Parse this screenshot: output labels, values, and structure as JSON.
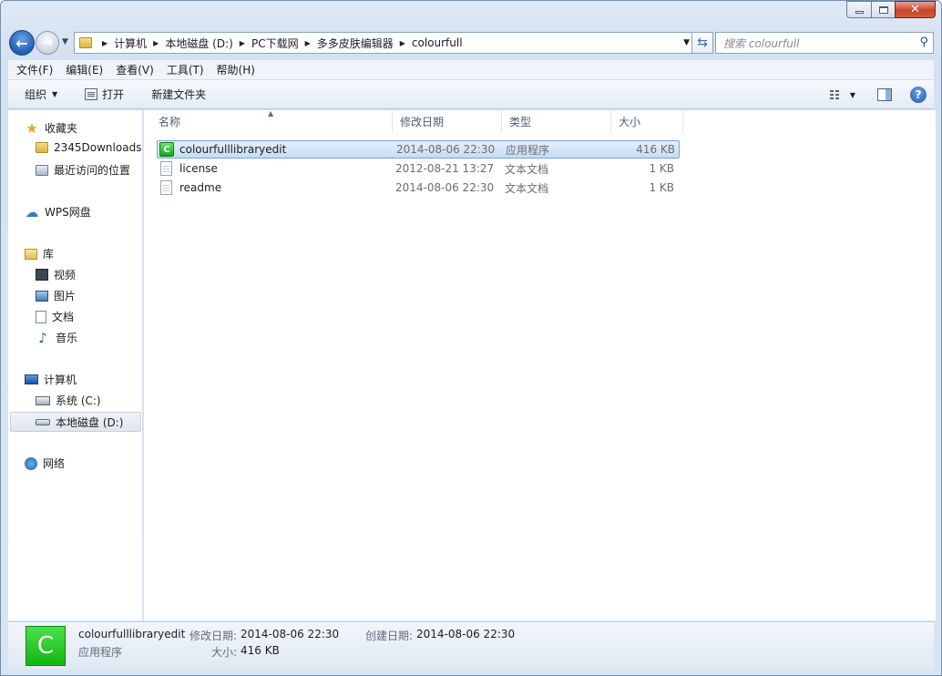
{
  "address": {
    "crumbs": [
      "计算机",
      "本地磁盘 (D:)",
      "PC下载网",
      "多多皮肤编辑器",
      "colourfull"
    ]
  },
  "search": {
    "placeholder": "搜索 colourfull"
  },
  "menu": [
    "文件(F)",
    "编辑(E)",
    "查看(V)",
    "工具(T)",
    "帮助(H)"
  ],
  "commands": {
    "organize": "组织",
    "open": "打开",
    "new_folder": "新建文件夹"
  },
  "nav": {
    "favorites": "收藏夹",
    "fav_items": [
      "2345Downloads",
      "最近访问的位置"
    ],
    "wps": "WPS网盘",
    "libraries": "库",
    "lib_items": [
      "视频",
      "图片",
      "文档",
      "音乐"
    ],
    "computer": "计算机",
    "drives": [
      "系统 (C:)",
      "本地磁盘 (D:)"
    ],
    "network": "网络"
  },
  "columns": [
    "名称",
    "修改日期",
    "类型",
    "大小"
  ],
  "files": [
    {
      "name": "colourfulllibraryedit",
      "date": "2014-08-06 22:30",
      "type": "应用程序",
      "size": "416 KB"
    },
    {
      "name": "license",
      "date": "2012-08-21 13:27",
      "type": "文本文档",
      "size": "1 KB"
    },
    {
      "name": "readme",
      "date": "2014-08-06 22:30",
      "type": "文本文档",
      "size": "1 KB"
    }
  ],
  "details": {
    "name": "colourfulllibraryedit",
    "kind": "应用程序",
    "modified_label": "修改日期:",
    "modified": "2014-08-06 22:30",
    "created_label": "创建日期:",
    "created": "2014-08-06 22:30",
    "size_label": "大小:",
    "size": "416 KB"
  },
  "colors": {
    "accent": "#1e5bb4",
    "selection": "#c7dcf6",
    "app_icon": "#16a616"
  }
}
